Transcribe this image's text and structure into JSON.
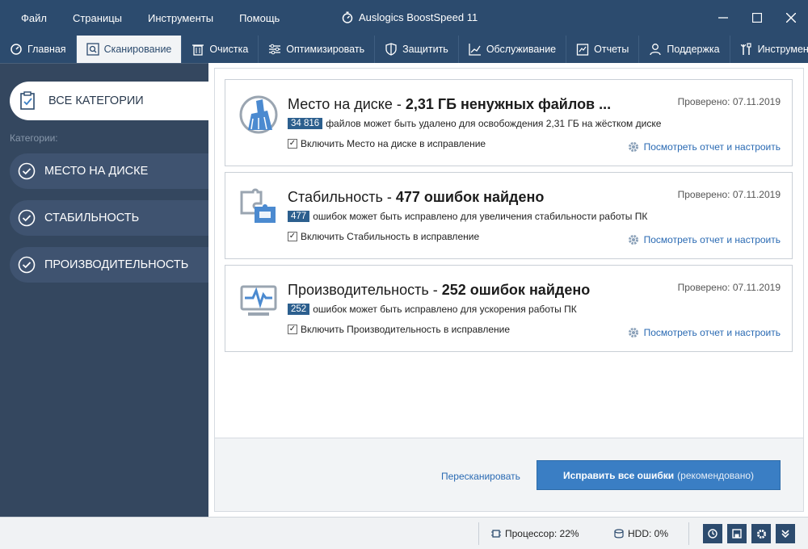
{
  "window": {
    "title": "Auslogics BoostSpeed 11",
    "menu": [
      "Файл",
      "Страницы",
      "Инструменты",
      "Помощь"
    ]
  },
  "tabs": [
    {
      "label": "Главная",
      "icon": "home-icon",
      "active": false
    },
    {
      "label": "Сканирование",
      "icon": "scan-icon",
      "active": true
    },
    {
      "label": "Очистка",
      "icon": "trash-icon",
      "active": false
    },
    {
      "label": "Оптимизировать",
      "icon": "sliders-icon",
      "active": false
    },
    {
      "label": "Защитить",
      "icon": "shield-icon",
      "active": false
    },
    {
      "label": "Обслуживание",
      "icon": "maintenance-icon",
      "active": false
    },
    {
      "label": "Отчеты",
      "icon": "report-icon",
      "active": false
    },
    {
      "label": "Поддержка",
      "icon": "person-icon",
      "active": false
    },
    {
      "label": "Инструменты",
      "icon": "tools-icon",
      "active": false
    }
  ],
  "sidebar": {
    "all_label": "ВСЕ КАТЕГОРИИ",
    "categories_label": "Категории:",
    "items": [
      {
        "label": "МЕСТО НА ДИСКЕ"
      },
      {
        "label": "СТАБИЛЬНОСТЬ"
      },
      {
        "label": "ПРОИЗВОДИТЕЛЬНОСТЬ"
      }
    ]
  },
  "cards": [
    {
      "title_prefix": "Место на диске - ",
      "title_bold": "2,31 ГБ ненужных файлов ...",
      "date": "Проверено: 07.11.2019",
      "badge": "34 816",
      "desc": "файлов может быть удалено для освобождения 2,31 ГБ на жёстком диске",
      "checkbox_label": "Включить Место на диске в исправление",
      "report_link": "Посмотреть отчет и настроить",
      "icon": "broom-icon"
    },
    {
      "title_prefix": "Стабильность - ",
      "title_bold": "477 ошибок найдено",
      "date": "Проверено: 07.11.2019",
      "badge": "477",
      "desc": "ошибок может быть исправлено для увеличения стабильности работы ПК",
      "checkbox_label": "Включить Стабильность в исправление",
      "report_link": "Посмотреть отчет и настроить",
      "icon": "puzzle-icon"
    },
    {
      "title_prefix": "Производительность - ",
      "title_bold": "252 ошибок найдено",
      "date": "Проверено: 07.11.2019",
      "badge": "252",
      "desc": "ошибок может быть исправлено для ускорения работы ПК",
      "checkbox_label": "Включить Производительность в исправление",
      "report_link": "Посмотреть отчет и настроить",
      "icon": "monitor-pulse-icon"
    }
  ],
  "actions": {
    "rescan": "Пересканировать",
    "fix_bold": "Исправить все ошибки",
    "fix_rest": "(рекомендовано)"
  },
  "status": {
    "cpu": "Процессор: 22%",
    "hdd": "HDD: 0%"
  },
  "colors": {
    "titlebar": "#2c4b6e",
    "sidebar": "#34475f",
    "accent": "#3a7ec4",
    "link": "#2a6ab3"
  }
}
